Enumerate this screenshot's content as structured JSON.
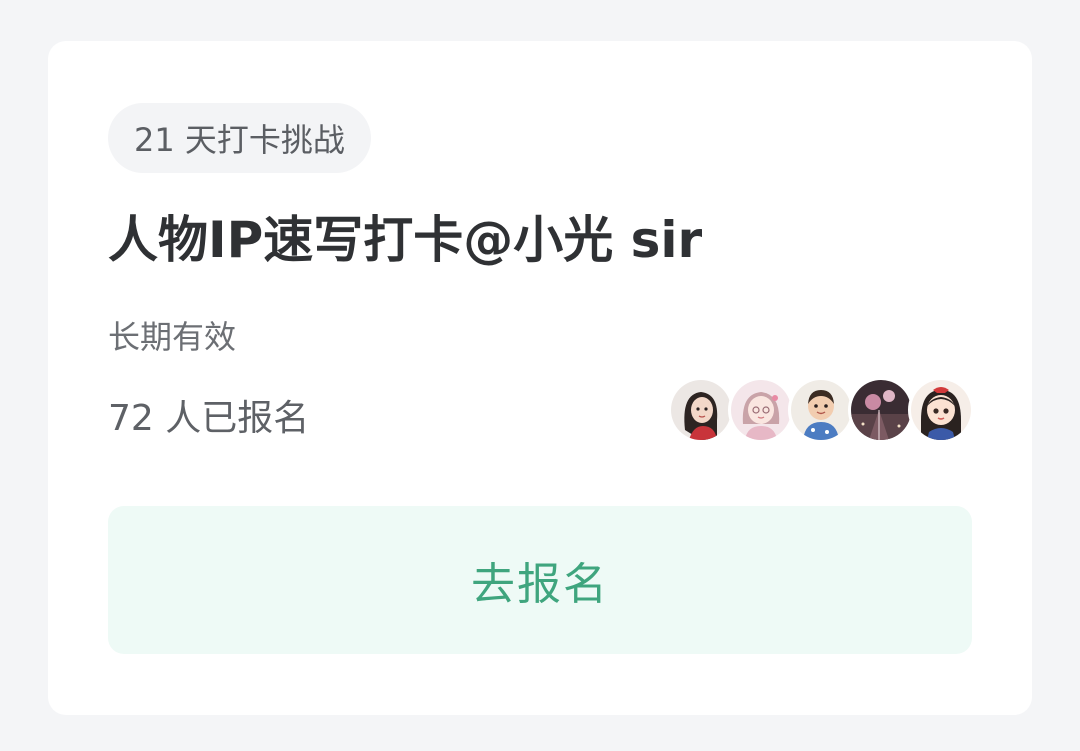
{
  "card": {
    "tag": "21 天打卡挑战",
    "title": "人物IP速写打卡@小光 sir",
    "validity": "长期有效",
    "signup_count": "72 人已报名",
    "avatars": [
      {
        "name": "participant-1"
      },
      {
        "name": "participant-2"
      },
      {
        "name": "participant-3"
      },
      {
        "name": "participant-4"
      },
      {
        "name": "participant-5"
      }
    ],
    "cta_label": "去报名"
  },
  "colors": {
    "background": "#f4f5f7",
    "card": "#ffffff",
    "cta_bg": "#eefaf6",
    "cta_text": "#3fa57e"
  }
}
